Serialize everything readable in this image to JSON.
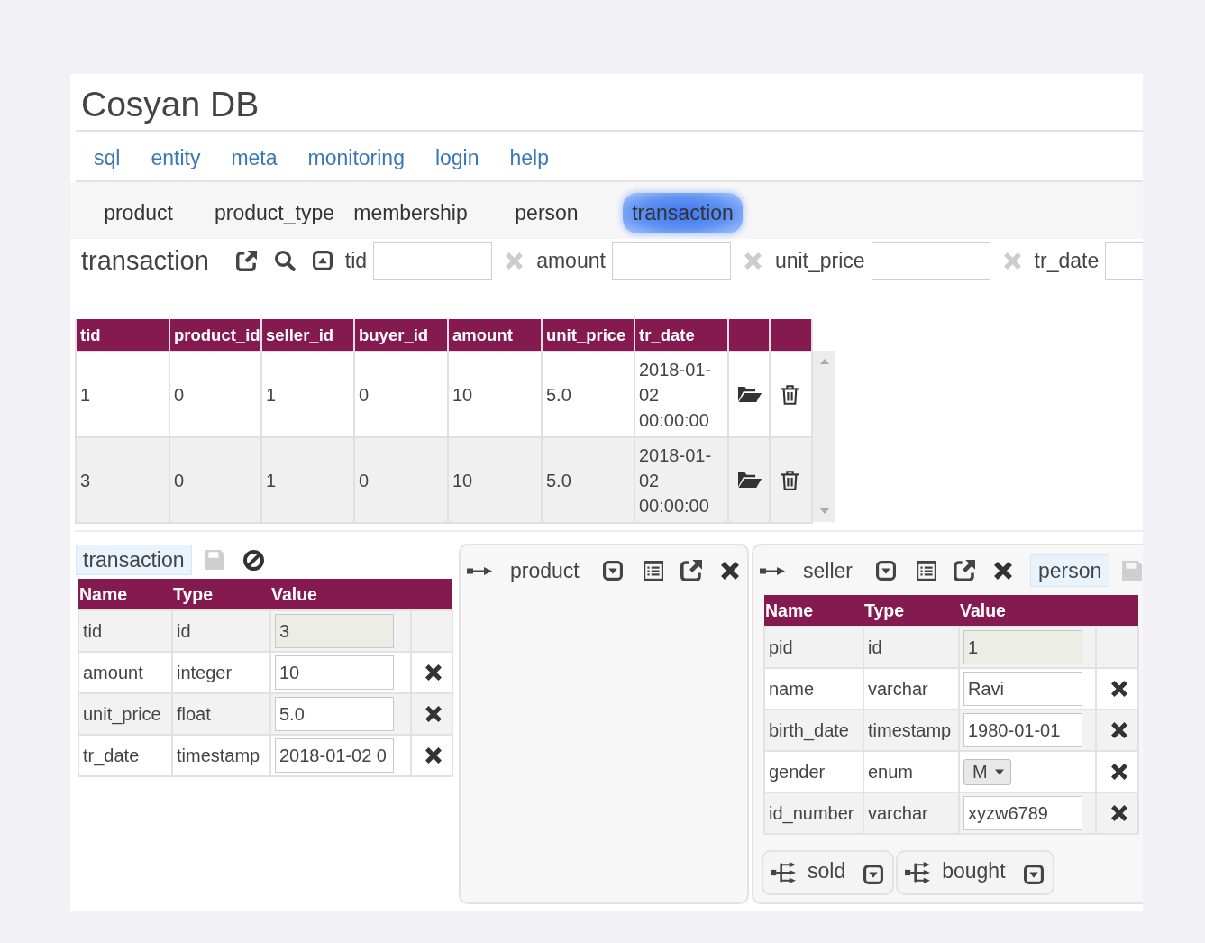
{
  "app": {
    "title": "Cosyan DB"
  },
  "nav": [
    {
      "label": "sql"
    },
    {
      "label": "entity"
    },
    {
      "label": "meta"
    },
    {
      "label": "monitoring"
    },
    {
      "label": "login"
    },
    {
      "label": "help"
    }
  ],
  "entity_tabs": [
    {
      "label": "product",
      "selected": false
    },
    {
      "label": "product_type",
      "selected": false
    },
    {
      "label": "membership",
      "selected": false
    },
    {
      "label": "person",
      "selected": false
    },
    {
      "label": "transaction",
      "selected": true
    }
  ],
  "search": {
    "title": "transaction",
    "filters": [
      {
        "label": "tid",
        "clear": true
      },
      {
        "label": "amount",
        "clear": true
      },
      {
        "label": "unit_price",
        "clear": true
      },
      {
        "label": "tr_date",
        "clear": false
      }
    ]
  },
  "table": {
    "columns": [
      "tid",
      "product_id",
      "seller_id",
      "buyer_id",
      "amount",
      "unit_price",
      "tr_date"
    ],
    "rows": [
      {
        "cells": [
          "1",
          "0",
          "1",
          "0",
          "10",
          "5.0",
          "2018-01-02 00:00:00"
        ]
      },
      {
        "cells": [
          "3",
          "0",
          "1",
          "0",
          "10",
          "5.0",
          "2018-01-02 00:00:00"
        ]
      }
    ]
  },
  "editor": {
    "title": "transaction",
    "save_disabled": true,
    "columns": [
      "Name",
      "Type",
      "Value"
    ],
    "fields": [
      {
        "name": "tid",
        "type": "id",
        "value": "3",
        "kind": "key"
      },
      {
        "name": "amount",
        "type": "integer",
        "value": "10",
        "kind": "text"
      },
      {
        "name": "unit_price",
        "type": "float",
        "value": "5.0",
        "kind": "text"
      },
      {
        "name": "tr_date",
        "type": "timestamp",
        "value": "2018-01-02 0",
        "kind": "text"
      }
    ]
  },
  "links": [
    {
      "label": "product"
    },
    {
      "label": "seller",
      "entity": "person",
      "save_disabled": true,
      "columns": [
        "Name",
        "Type",
        "Value"
      ],
      "fields": [
        {
          "name": "pid",
          "type": "id",
          "value": "1",
          "kind": "key"
        },
        {
          "name": "name",
          "type": "varchar",
          "value": "Ravi",
          "kind": "text"
        },
        {
          "name": "birth_date",
          "type": "timestamp",
          "value": "1980-01-01",
          "kind": "text"
        },
        {
          "name": "gender",
          "type": "enum",
          "value": "M",
          "kind": "select"
        },
        {
          "name": "id_number",
          "type": "varchar",
          "value": "xyzw6789",
          "kind": "text"
        }
      ],
      "references": [
        {
          "label": "sold"
        },
        {
          "label": "bought"
        }
      ]
    }
  ]
}
